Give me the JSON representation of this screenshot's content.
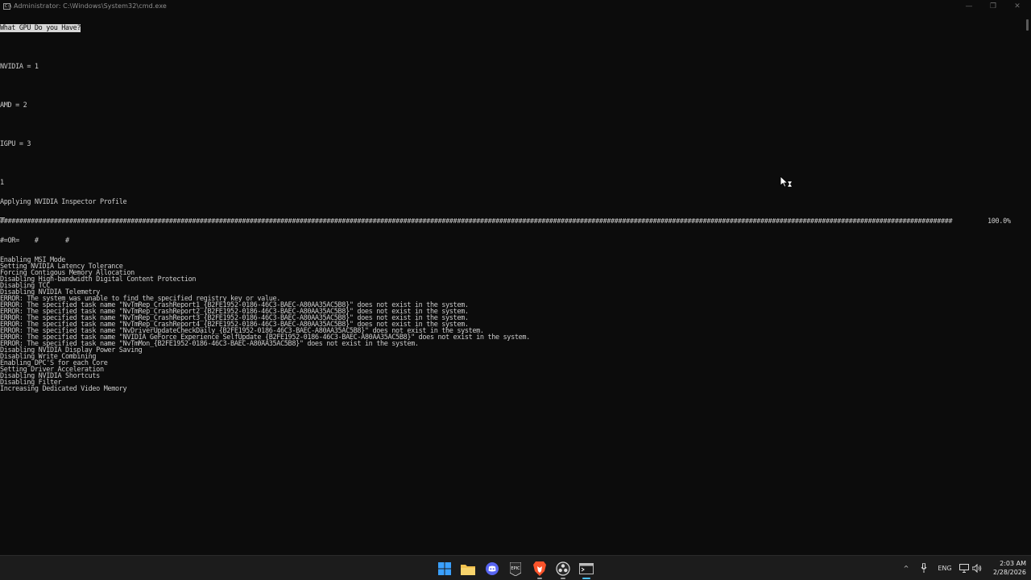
{
  "window": {
    "title": "Administrator: C:\\Windows\\System32\\cmd.exe",
    "app_icon": "cmd-icon",
    "minimize_symbol": "—",
    "maximize_symbol": "❐",
    "close_symbol": "✕"
  },
  "console": {
    "prompt_question": "What GPU Do you Have?",
    "options": [
      "NVIDIA = 1",
      "AMD = 2",
      "IGPU = 3"
    ],
    "user_input": "1",
    "applying_line": "Applying NVIDIA Inspector Profile",
    "progress_bar_text": "########################################################################################################################################################################################################################################################",
    "progress_percent": "100.0%",
    "progress_fraction": 1.0,
    "progress_garbage": "#=OR=    #       #",
    "log_lines": [
      "Enabling MSI Mode",
      "Setting NVIDIA Latency Tolerance",
      "Forcing Contigous Memory Allocation",
      "Disabling High-bandwidth Digital Content Protection",
      "Disabling TCC",
      "Disabling NVIDIA Telemetry",
      "ERROR: The system was unable to find the specified registry key or value.",
      "ERROR: The specified task name \"NvTmRep_CrashReport1_{B2FE1952-0186-46C3-BAEC-A80AA35AC5B8}\" does not exist in the system.",
      "ERROR: The specified task name \"NvTmRep_CrashReport2_{B2FE1952-0186-46C3-BAEC-A80AA35AC5B8}\" does not exist in the system.",
      "ERROR: The specified task name \"NvTmRep_CrashReport3_{B2FE1952-0186-46C3-BAEC-A80AA35AC5B8}\" does not exist in the system.",
      "ERROR: The specified task name \"NvTmRep_CrashReport4_{B2FE1952-0186-46C3-BAEC-A80AA35AC5B8}\" does not exist in the system.",
      "ERROR: The specified task name \"NvDriverUpdateCheckDaily_{B2FE1952-0186-46C3-BAEC-A80AA35AC5B8}\" does not exist in the system.",
      "ERROR: The specified task name \"NVIDIA GeForce Experience SelfUpdate_{B2FE1952-0186-46C3-BAEC-A80AA35AC5B8}\" does not exist in the system.",
      "ERROR: The specified task name \"NvTmMon_{B2FE1952-0186-46C3-BAEC-A80AA35AC5B8}\" does not exist in the system.",
      "Disabling NVIDIA Display Power Saving",
      "Disabling Write Combining",
      "Enabling DPC'S for each Core",
      "Setting Driver Acceleration",
      "Disabling NVIDIA Shortcuts",
      "Disabling Filter",
      "Increasing Dedicated Video Memory"
    ]
  },
  "taskbar": {
    "icons": [
      "windows-start-icon",
      "file-explorer-icon",
      "discord-icon",
      "epic-games-icon",
      "brave-browser-icon",
      "obs-studio-icon",
      "terminal-icon"
    ],
    "tray": {
      "chevron_symbol": "^",
      "language": "ENG",
      "time": "2:03 AM",
      "date": "2/28/2026"
    },
    "colors": {
      "start": "#3aa0ff",
      "folder": "#f2c14e",
      "discord": "#5865f2",
      "brave": "#fb542b"
    }
  }
}
